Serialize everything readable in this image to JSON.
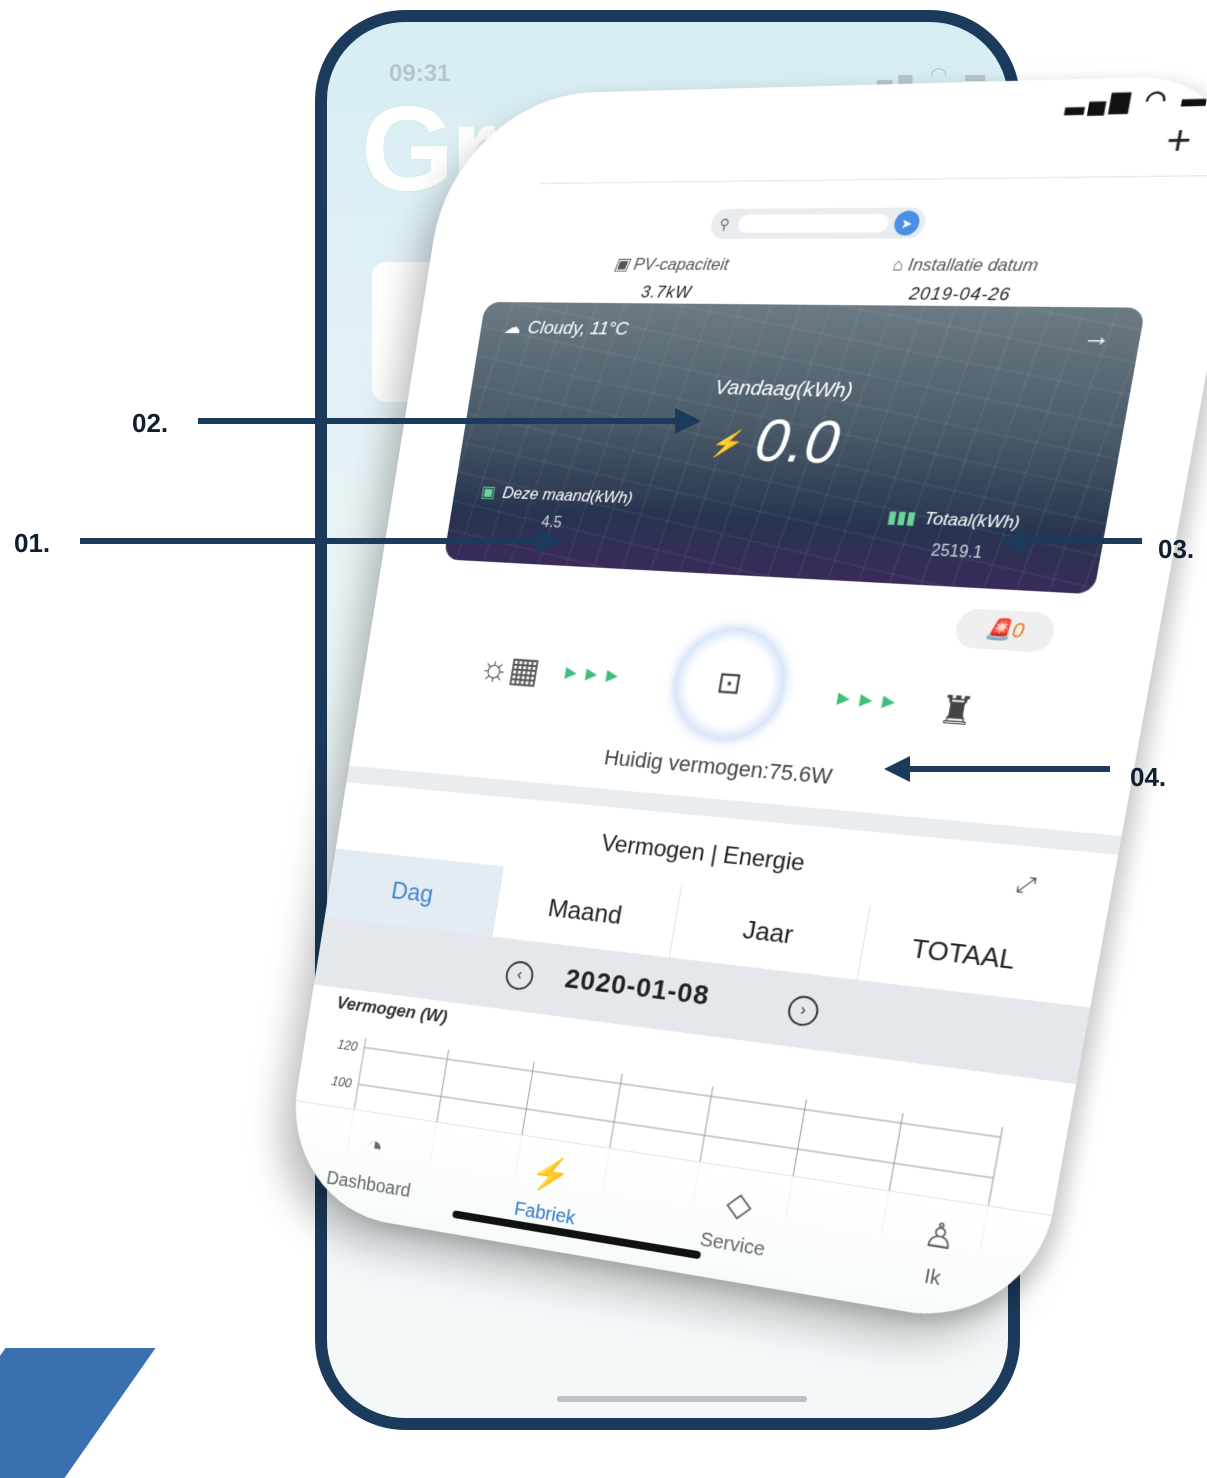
{
  "back_phone": {
    "time": "09:31",
    "brand": "Grow"
  },
  "status_bar": {
    "signal_icons": "▂▄▆ ◠ ▬"
  },
  "header": {
    "add_label": "+"
  },
  "plant_info": {
    "pv_capacity_label": "PV-capaciteit",
    "pv_capacity_value": "3.7kW",
    "install_date_label": "Installatie datum",
    "install_date_value": "2019-04-26"
  },
  "energy_card": {
    "weather": "Cloudy,  11°C",
    "today_label": "Vandaag(kWh)",
    "today_value": "0.0",
    "month_label": "Deze maand(kWh)",
    "month_value": "4.5",
    "total_label": "Totaal(kWh)",
    "total_value": "2519.1"
  },
  "alarm": {
    "count": "0"
  },
  "flow": {
    "current_power": "Huidig vermogen:75.6W"
  },
  "chart_section": {
    "title": "Vermogen | Energie",
    "tabs": [
      "Dag",
      "Maand",
      "Jaar",
      "TOTAAL"
    ],
    "active_tab": "Dag",
    "date": "2020-01-08",
    "ylabel": "Vermogen (W)"
  },
  "chart_data": {
    "type": "line",
    "title": "",
    "xlabel": "",
    "ylabel": "Vermogen (W)",
    "y_ticks": [
      "120",
      "100"
    ],
    "grid": true,
    "series": []
  },
  "nav": {
    "items": [
      {
        "label": "Dashboard",
        "icon": "dashboard-icon"
      },
      {
        "label": "Fabriek",
        "icon": "plant-icon"
      },
      {
        "label": "Service",
        "icon": "service-icon"
      },
      {
        "label": "Ik",
        "icon": "user-icon"
      }
    ],
    "active": "Fabriek"
  },
  "callouts": {
    "c01": "01.",
    "c02": "02.",
    "c03": "03.",
    "c04": "04."
  },
  "colors": {
    "accent": "#2f78c5",
    "frame": "#1b3a5c",
    "flow_arrow": "#3fbf7a",
    "alarm": "#ef7a2a"
  }
}
